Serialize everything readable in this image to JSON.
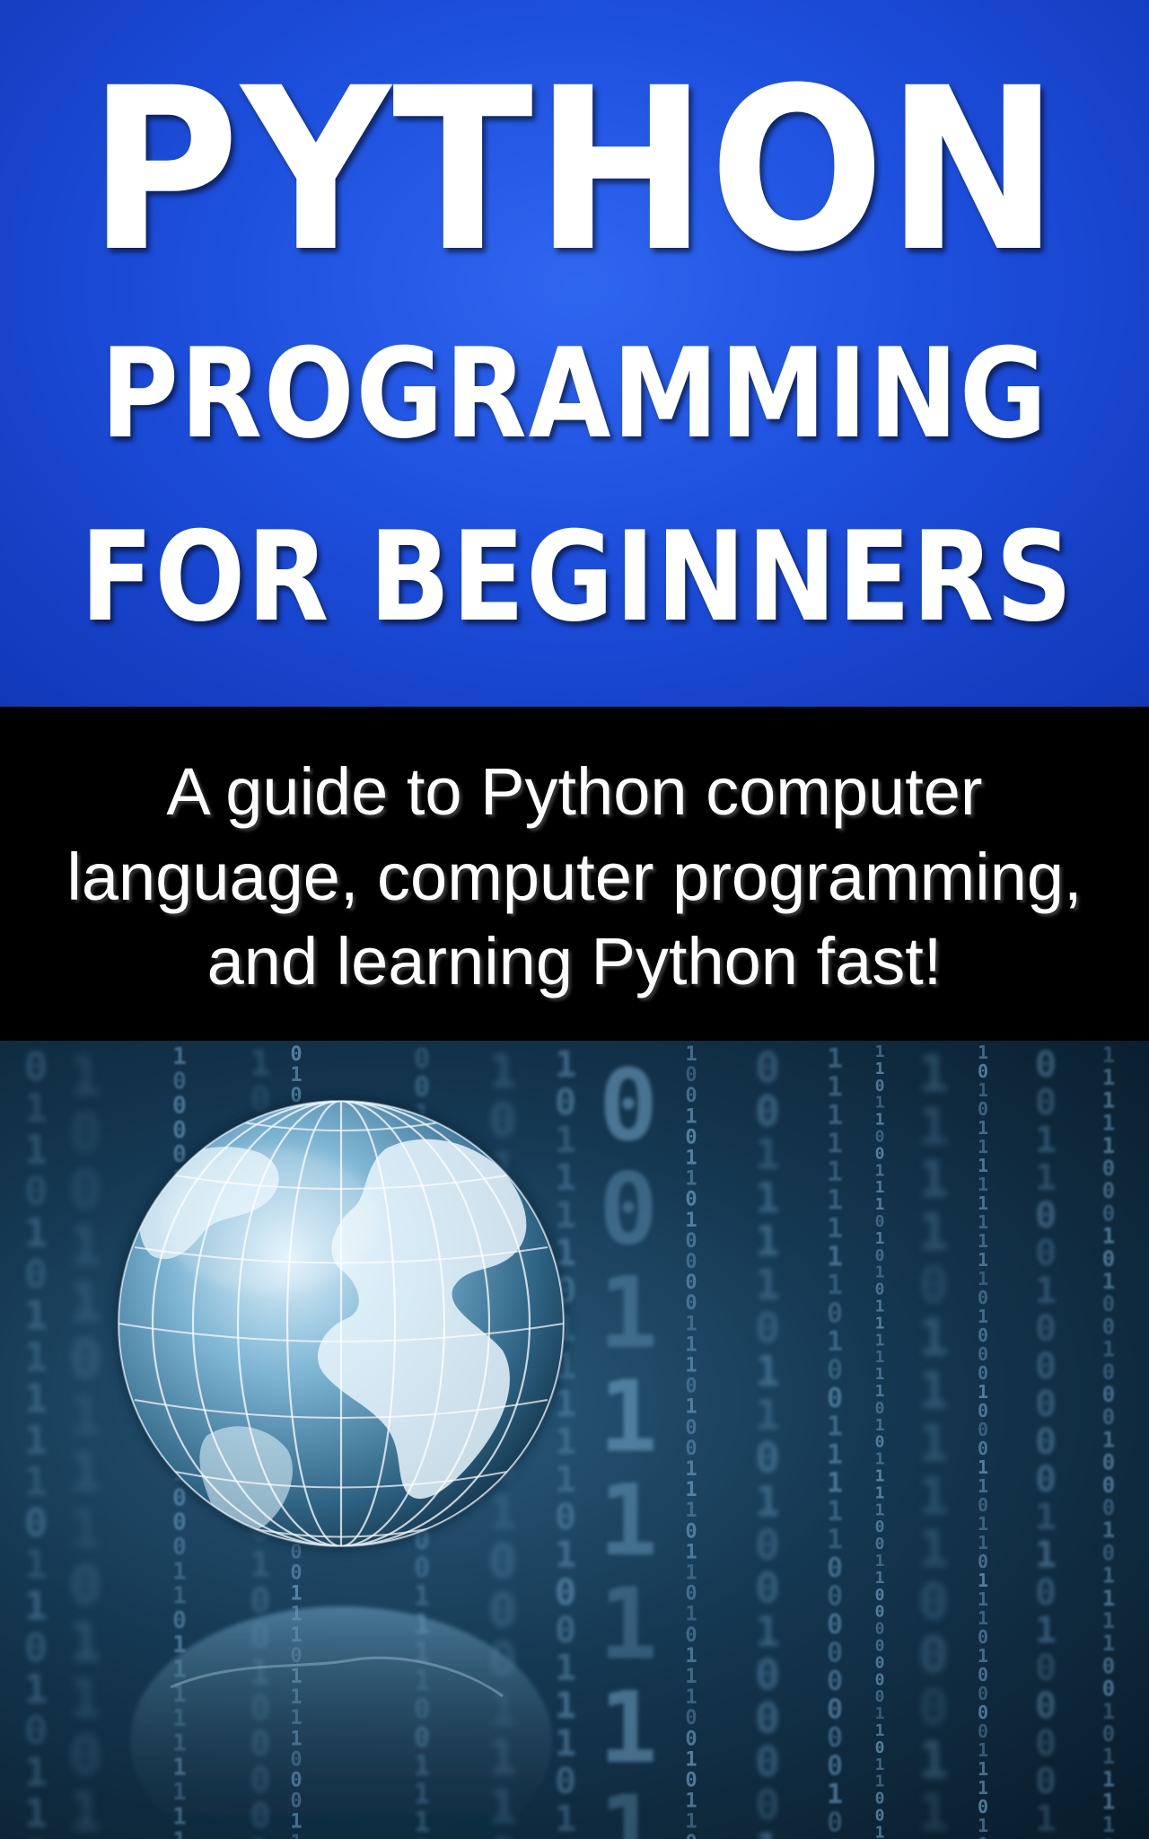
{
  "cover": {
    "title": {
      "line1": "PYTHON",
      "line2": "PROGRAMMING",
      "line3": "FOR BEGINNERS"
    },
    "subtitle": {
      "line1": "A guide to Python computer",
      "line2": "language, computer programming,",
      "line3": "and learning Python fast!"
    },
    "artwork": {
      "icons": [
        "globe-icon",
        "binary-code-background"
      ],
      "binary_glyphs": [
        "1",
        "0"
      ]
    }
  },
  "colors": {
    "title_band": "#1d4fdd",
    "title_text": "#ffffff",
    "subtitle_band": "#000000",
    "subtitle_text": "#ffffff",
    "art_background": "#153852",
    "binary_glow": "#7fb4d8"
  }
}
